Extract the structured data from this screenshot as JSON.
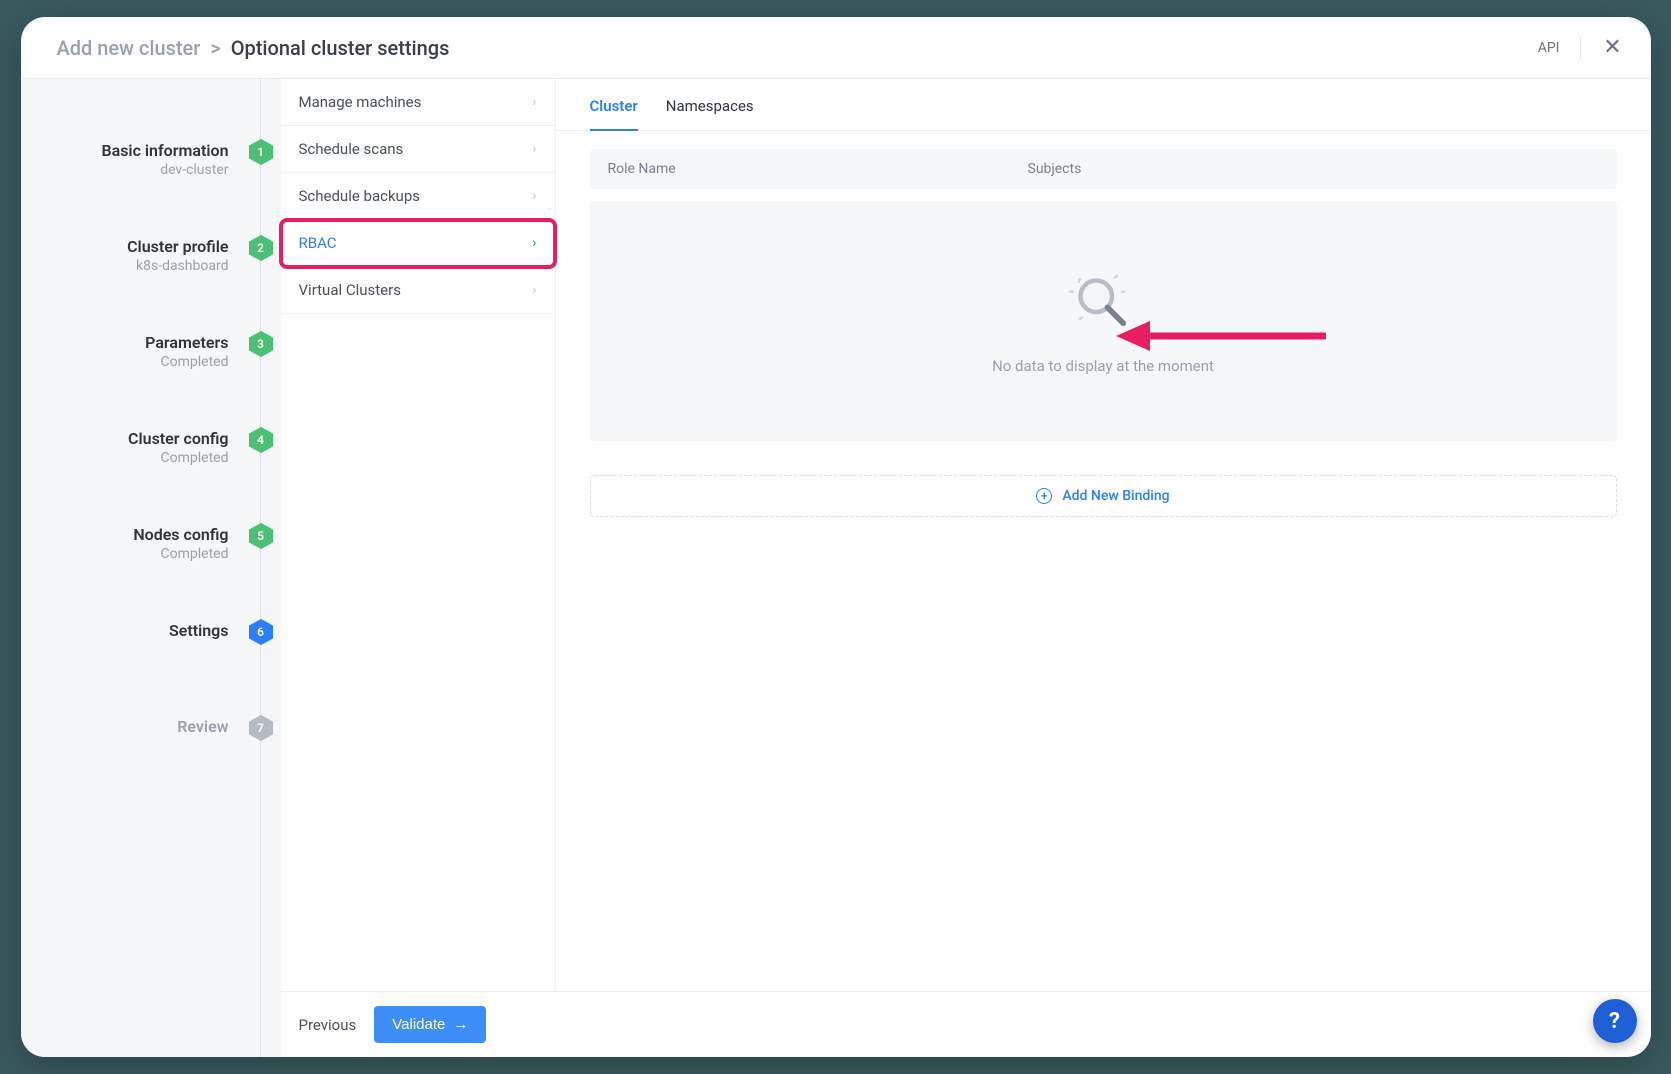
{
  "header": {
    "breadcrumb_root": "Add new cluster",
    "breadcrumb_sep": ">",
    "breadcrumb_leaf": "Optional cluster settings",
    "api": "API"
  },
  "steps": [
    {
      "num": "1",
      "title": "Basic information",
      "sub": "dev-cluster",
      "color": "green",
      "interactive": true
    },
    {
      "num": "2",
      "title": "Cluster profile",
      "sub": "k8s-dashboard",
      "color": "green",
      "interactive": true
    },
    {
      "num": "3",
      "title": "Parameters",
      "sub": "Completed",
      "color": "green",
      "interactive": true
    },
    {
      "num": "4",
      "title": "Cluster config",
      "sub": "Completed",
      "color": "green",
      "interactive": true
    },
    {
      "num": "5",
      "title": "Nodes config",
      "sub": "Completed",
      "color": "green",
      "interactive": true
    },
    {
      "num": "6",
      "title": "Settings",
      "sub": "",
      "color": "blue",
      "interactive": true,
      "active": true
    },
    {
      "num": "7",
      "title": "Review",
      "sub": "",
      "color": "grey",
      "interactive": true,
      "inactive": true
    }
  ],
  "submenu": [
    {
      "label": "Manage machines",
      "selected": false
    },
    {
      "label": "Schedule scans",
      "selected": false
    },
    {
      "label": "Schedule backups",
      "selected": false
    },
    {
      "label": "RBAC",
      "selected": true
    },
    {
      "label": "Virtual Clusters",
      "selected": false
    }
  ],
  "tabs": [
    {
      "label": "Cluster",
      "active": true
    },
    {
      "label": "Namespaces",
      "active": false
    }
  ],
  "table": {
    "col_role": "Role Name",
    "col_subjects": "Subjects",
    "empty_text": "No data to display at the moment"
  },
  "add_binding": "Add New Binding",
  "footer": {
    "prev": "Previous",
    "validate": "Validate"
  },
  "help": "?"
}
